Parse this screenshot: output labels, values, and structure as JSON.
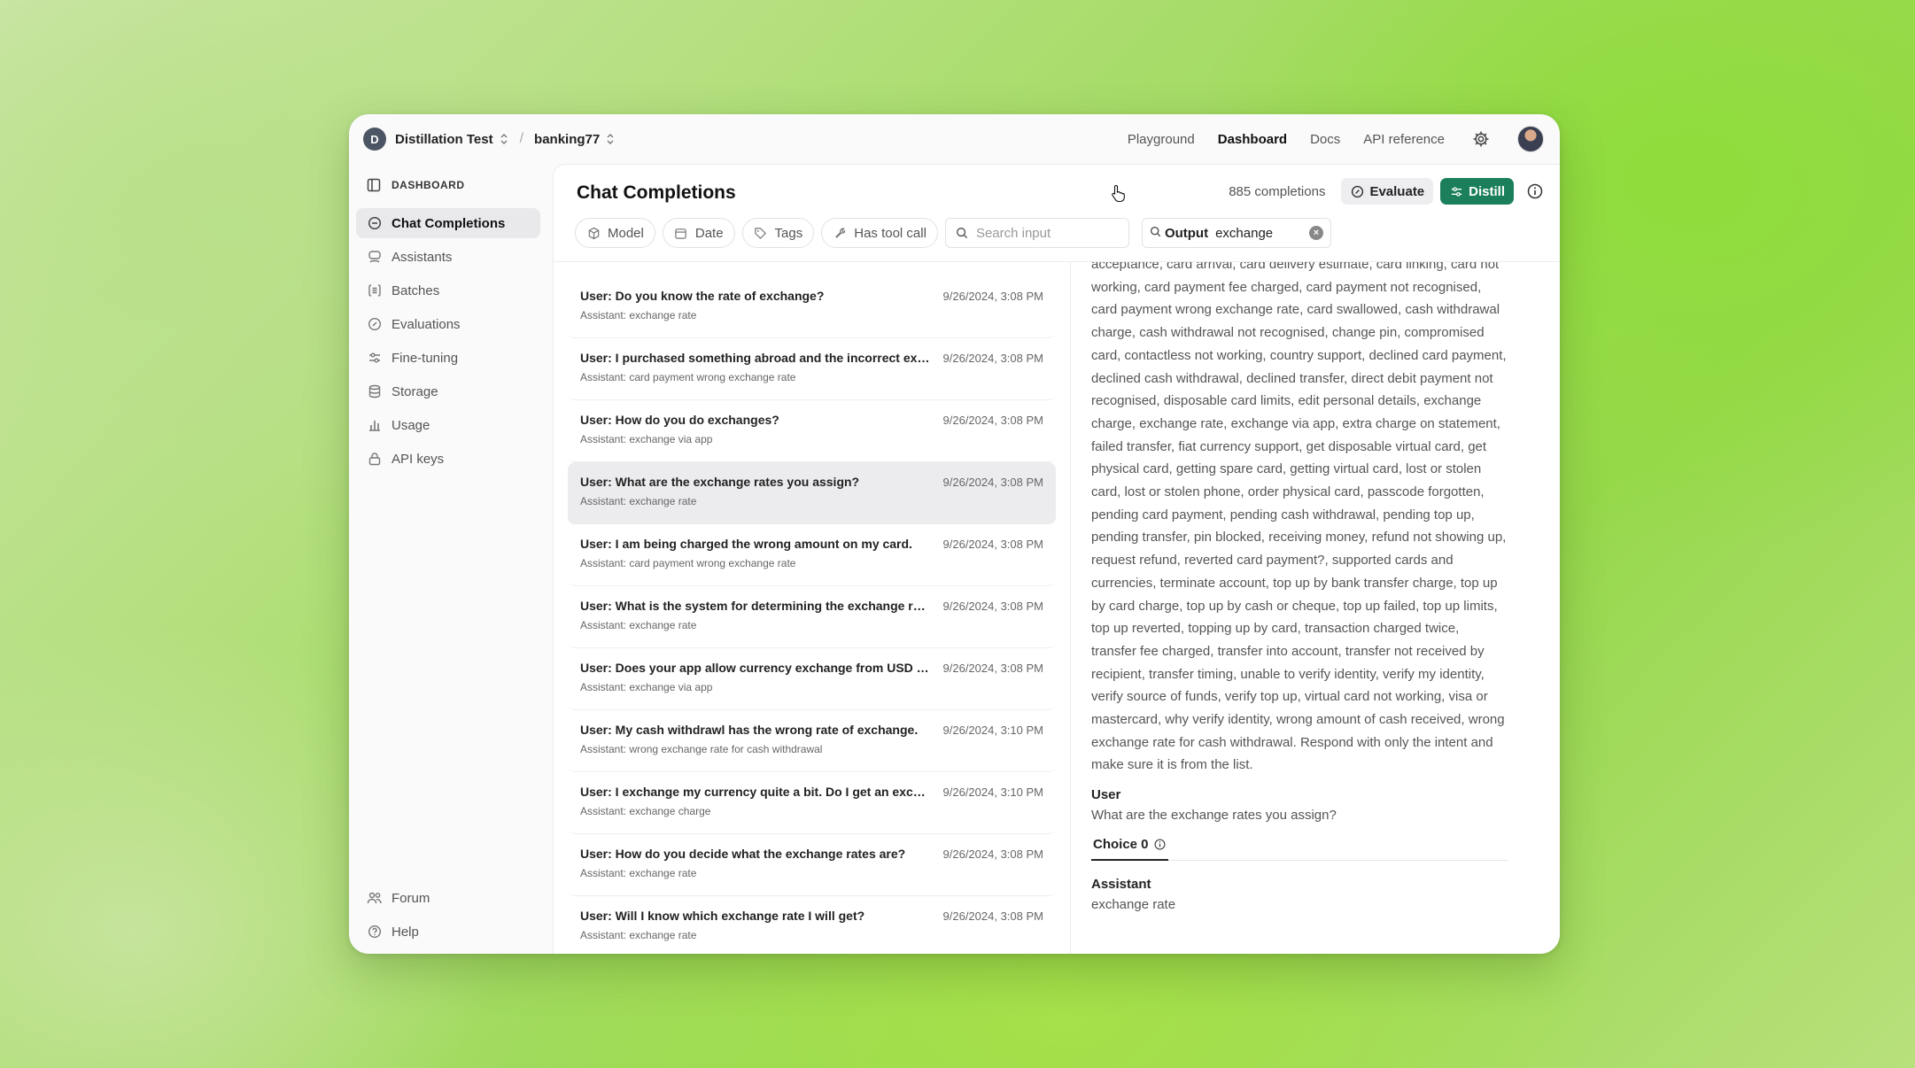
{
  "topbar": {
    "org_initial": "D",
    "org_name": "Distillation Test",
    "project_name": "banking77",
    "nav": [
      "Playground",
      "Dashboard",
      "Docs",
      "API reference"
    ],
    "active_nav": "Dashboard"
  },
  "sidebar": {
    "header": "DASHBOARD",
    "items": [
      {
        "label": "Chat Completions",
        "icon": "chat-icon",
        "active": true
      },
      {
        "label": "Assistants",
        "icon": "assistant-icon"
      },
      {
        "label": "Batches",
        "icon": "batches-icon"
      },
      {
        "label": "Evaluations",
        "icon": "evaluations-icon"
      },
      {
        "label": "Fine-tuning",
        "icon": "fine-tuning-icon"
      },
      {
        "label": "Storage",
        "icon": "storage-icon"
      },
      {
        "label": "Usage",
        "icon": "usage-icon"
      },
      {
        "label": "API keys",
        "icon": "lock-icon"
      }
    ],
    "bottom": [
      {
        "label": "Forum",
        "icon": "people-icon"
      },
      {
        "label": "Help",
        "icon": "help-icon"
      }
    ]
  },
  "main": {
    "title": "Chat Completions",
    "count": "885 completions",
    "evaluate_label": "Evaluate",
    "distill_label": "Distill",
    "accent_color": "#1a7f5a",
    "filters": {
      "model": "Model",
      "date": "Date",
      "tags": "Tags",
      "tool_call": "Has tool call",
      "search_placeholder": "Search input",
      "output_label": "Output",
      "output_value": "exchange"
    }
  },
  "completions": [
    {
      "user": "User: Do you know the rate of exchange?",
      "assistant": "Assistant: exchange rate",
      "time": "9/26/2024, 3:08 PM"
    },
    {
      "user": "User: I purchased something abroad and the incorrect excha...",
      "assistant": "Assistant: card payment wrong exchange rate",
      "time": "9/26/2024, 3:08 PM"
    },
    {
      "user": "User: How do you do exchanges?",
      "assistant": "Assistant: exchange via app",
      "time": "9/26/2024, 3:08 PM"
    },
    {
      "user": "User: What are the exchange rates you assign?",
      "assistant": "Assistant: exchange rate",
      "time": "9/26/2024, 3:08 PM",
      "selected": true
    },
    {
      "user": "User: I am being charged the wrong amount on my card.",
      "assistant": "Assistant: card payment wrong exchange rate",
      "time": "9/26/2024, 3:08 PM"
    },
    {
      "user": "User: What is the system for determining the exchange rate?",
      "assistant": "Assistant: exchange rate",
      "time": "9/26/2024, 3:08 PM"
    },
    {
      "user": "User: Does your app allow currency exchange from USD to G...",
      "assistant": "Assistant: exchange via app",
      "time": "9/26/2024, 3:08 PM"
    },
    {
      "user": "User: My cash withdrawl has the wrong rate of exchange.",
      "assistant": "Assistant: wrong exchange rate for cash withdrawal",
      "time": "9/26/2024, 3:10 PM"
    },
    {
      "user": "User: I exchange my currency quite a bit. Do I get an exchang...",
      "assistant": "Assistant: exchange charge",
      "time": "9/26/2024, 3:10 PM"
    },
    {
      "user": "User: How do you decide what the exchange rates are?",
      "assistant": "Assistant: exchange rate",
      "time": "9/26/2024, 3:08 PM"
    },
    {
      "user": "User: Will I know which exchange rate I will get?",
      "assistant": "Assistant: exchange rate",
      "time": "9/26/2024, 3:08 PM"
    }
  ],
  "detail": {
    "system_text": "acceptance, card arrival, card delivery estimate, card linking, card not working, card payment fee charged, card payment not recognised, card payment wrong exchange rate, card swallowed, cash withdrawal charge, cash withdrawal not recognised, change pin, compromised card, contactless not working, country support, declined card payment, declined cash withdrawal, declined transfer, direct debit payment not recognised, disposable card limits, edit personal details, exchange charge, exchange rate, exchange via app, extra charge on statement, failed transfer, fiat currency support, get disposable virtual card, get physical card, getting spare card, getting virtual card, lost or stolen card, lost or stolen phone, order physical card, passcode forgotten, pending card payment, pending cash withdrawal, pending top up, pending transfer, pin blocked, receiving money, refund not showing up, request refund, reverted card payment?, supported cards and currencies, terminate account, top up by bank transfer charge, top up by card charge, top up by cash or cheque, top up failed, top up limits, top up reverted, topping up by card, transaction charged twice, transfer fee charged, transfer into account, transfer not received by recipient, transfer timing, unable to verify identity, verify my identity, verify source of funds, verify top up, virtual card not working, visa or mastercard, why verify identity, wrong amount of cash received, wrong exchange rate for cash withdrawal. Respond with only the intent and make sure it is from the list.",
    "user_role": "User",
    "user_message": "What are the exchange rates you assign?",
    "choice_tab": "Choice 0",
    "assistant_role": "Assistant",
    "assistant_message": "exchange rate"
  }
}
